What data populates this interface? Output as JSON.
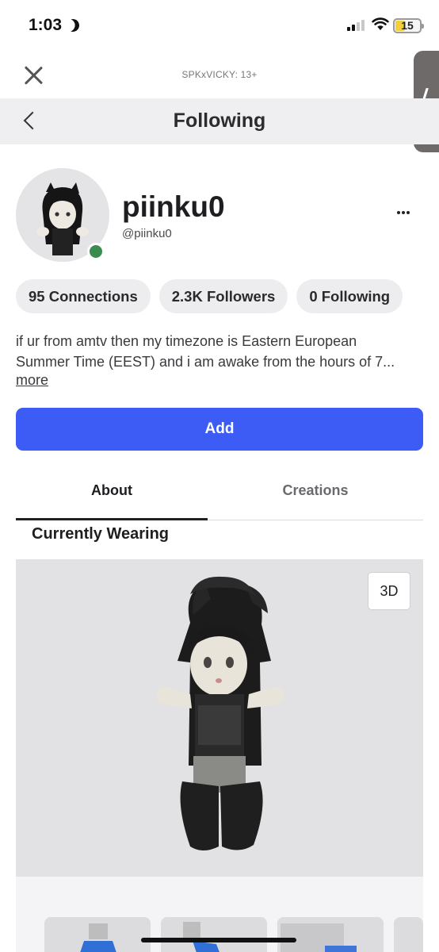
{
  "status_bar": {
    "time": "1:03",
    "battery": "15"
  },
  "header": {
    "account_label": "SPKxVICKY: 13+",
    "nav_title": "Following"
  },
  "profile": {
    "display_name": "piinku0",
    "username": "@piinku0",
    "online_color": "#3b8c4f",
    "stats": [
      {
        "label": "95 Connections"
      },
      {
        "label": "2.3K Followers"
      },
      {
        "label": "0 Following"
      }
    ],
    "bio_lines": [
      "if ur from amtv then my timezone is Eastern European",
      "Summer Time (EEST) and i am awake from the hours of 7..."
    ],
    "bio_more": "more",
    "add_label": "Add",
    "accent_color": "#3d5cf5"
  },
  "tabs": [
    {
      "label": "About",
      "active": true
    },
    {
      "label": "Creations",
      "active": false
    }
  ],
  "wearing": {
    "title": "Currently Wearing",
    "view_3d_label": "3D"
  }
}
